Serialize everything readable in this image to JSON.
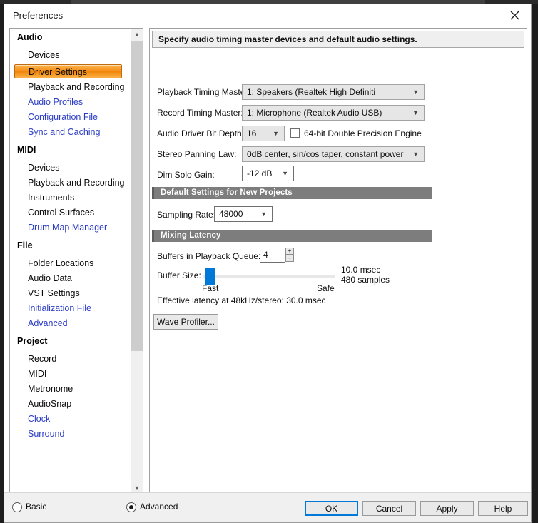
{
  "window": {
    "title": "Preferences",
    "close_icon": "close-icon"
  },
  "sidebar": {
    "scrollbar": {
      "up_icon": "chevron-up-icon",
      "down_icon": "chevron-down-icon"
    },
    "groups": [
      {
        "label": "Audio",
        "items": [
          {
            "label": "Devices",
            "advanced": false,
            "selected": false
          },
          {
            "label": "Driver Settings",
            "advanced": false,
            "selected": true
          },
          {
            "label": "Playback and Recording",
            "advanced": false,
            "selected": false
          },
          {
            "label": "Audio Profiles",
            "advanced": true,
            "selected": false
          },
          {
            "label": "Configuration File",
            "advanced": true,
            "selected": false
          },
          {
            "label": "Sync and Caching",
            "advanced": true,
            "selected": false
          }
        ]
      },
      {
        "label": "MIDI",
        "items": [
          {
            "label": "Devices",
            "advanced": false,
            "selected": false
          },
          {
            "label": "Playback and Recording",
            "advanced": false,
            "selected": false
          },
          {
            "label": "Instruments",
            "advanced": false,
            "selected": false
          },
          {
            "label": "Control Surfaces",
            "advanced": false,
            "selected": false
          },
          {
            "label": "Drum Map Manager",
            "advanced": true,
            "selected": false
          }
        ]
      },
      {
        "label": "File",
        "items": [
          {
            "label": "Folder Locations",
            "advanced": false,
            "selected": false
          },
          {
            "label": "Audio Data",
            "advanced": false,
            "selected": false
          },
          {
            "label": "VST Settings",
            "advanced": false,
            "selected": false
          },
          {
            "label": "Initialization File",
            "advanced": true,
            "selected": false
          },
          {
            "label": "Advanced",
            "advanced": true,
            "selected": false
          }
        ]
      },
      {
        "label": "Project",
        "items": [
          {
            "label": "Record",
            "advanced": false,
            "selected": false
          },
          {
            "label": "MIDI",
            "advanced": false,
            "selected": false
          },
          {
            "label": "Metronome",
            "advanced": false,
            "selected": false
          },
          {
            "label": "AudioSnap",
            "advanced": false,
            "selected": false
          },
          {
            "label": "Clock",
            "advanced": true,
            "selected": false
          },
          {
            "label": "Surround",
            "advanced": true,
            "selected": false
          }
        ]
      }
    ]
  },
  "content": {
    "description": "Specify audio timing master devices and default audio settings.",
    "fields": {
      "playback_timing_master": {
        "label": "Playback Timing Master:",
        "value": "1: Speakers (Realtek High Definiti",
        "arrow": "chevron-down-icon"
      },
      "record_timing_master": {
        "label": "Record Timing Master:",
        "value": "1: Microphone (Realtek Audio USB)",
        "arrow": "chevron-down-icon"
      },
      "bit_depth": {
        "label": "Audio Driver Bit Depth:",
        "value": "16",
        "arrow": "chevron-down-icon"
      },
      "double_precision": {
        "label": "64-bit Double Precision Engine",
        "checked": false
      },
      "stereo_panning_law": {
        "label": "Stereo Panning Law:",
        "value": "0dB center, sin/cos taper, constant power",
        "arrow": "chevron-down-icon"
      },
      "dim_solo_gain": {
        "label": "Dim Solo Gain:",
        "value": "-12 dB",
        "arrow": "chevron-down-icon"
      }
    },
    "section_defaults": {
      "title": "Default Settings for New Projects",
      "sampling_rate": {
        "label": "Sampling Rate:",
        "value": "48000",
        "arrow": "chevron-down-icon"
      }
    },
    "section_latency": {
      "title": "Mixing Latency",
      "buffers_in_playback_queue": {
        "label": "Buffers in Playback Queue:",
        "value": "4",
        "up": "+",
        "down": "–"
      },
      "buffer_size": {
        "label": "Buffer Size:",
        "min_label": "Fast",
        "max_label": "Safe",
        "msec": "10.0 msec",
        "samples": "480 samples",
        "position_percent": 2
      },
      "effective_latency": "Effective latency at 48kHz/stereo:  30.0 msec",
      "wave_profiler_button": "Wave Profiler..."
    }
  },
  "footer": {
    "mode_basic": "Basic",
    "mode_advanced": "Advanced",
    "mode_selected": "Advanced",
    "buttons": {
      "ok": "OK",
      "cancel": "Cancel",
      "apply": "Apply",
      "help": "Help"
    }
  },
  "colors": {
    "accent_selected": "#f18508",
    "advanced_link": "#2b3cc4",
    "focus_blue": "#0078d7",
    "section_bar": "#7d7d7d"
  }
}
